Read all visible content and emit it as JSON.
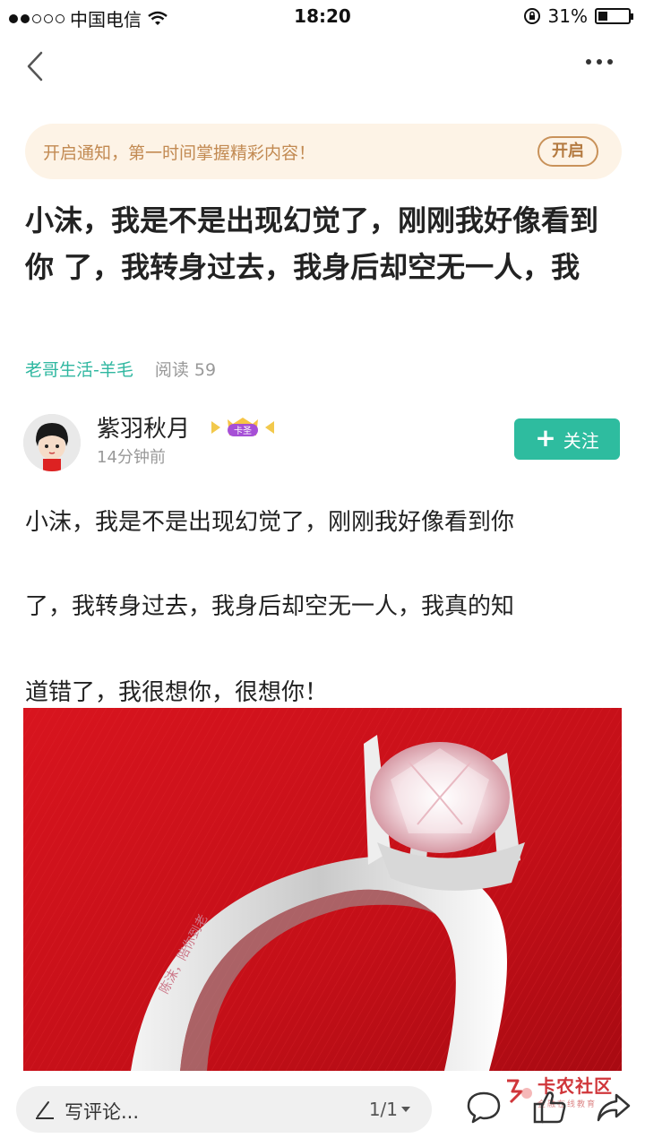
{
  "status_bar": {
    "carrier": "中国电信",
    "time": "18:20",
    "battery": "31%",
    "battery_level": 0.31
  },
  "notify": {
    "text": "开启通知，第一时间掌握精彩内容！",
    "button": "开启"
  },
  "article": {
    "title": "小沫，我是不是出现幻觉了，刚刚我好像看到你 了，我转身过去，我身后却空无一人，我",
    "category": "老哥生活-羊毛",
    "reads": "阅读 59",
    "author": {
      "name": "紫羽秋月",
      "badge": "卡圣",
      "time": "14分钟前"
    },
    "follow": "关注",
    "paragraphs": [
      "小沫，我是不是出现幻觉了，刚刚我好像看到你",
      "了，我转身过去，我身后却空无一人，我真的知",
      "道错了，我很想你，很想你！"
    ],
    "image_engraving": "陈沫，陪你到老"
  },
  "watermark": {
    "title": "卡农社区",
    "subtitle": "金融在线教育"
  },
  "bottom_bar": {
    "comment_placeholder": "写评论...",
    "page": "1/1"
  },
  "icons": [
    "back-icon",
    "more-icon",
    "wifi-icon",
    "lock-rotation-icon",
    "pen-icon",
    "comment-icon",
    "like-icon",
    "share-icon"
  ],
  "colors": {
    "accent": "#2ebc9f",
    "category": "#2fb7a0",
    "notify_bg": "#fdf3e6",
    "notify_text": "#c28a52",
    "watermark": "#d0363a"
  }
}
